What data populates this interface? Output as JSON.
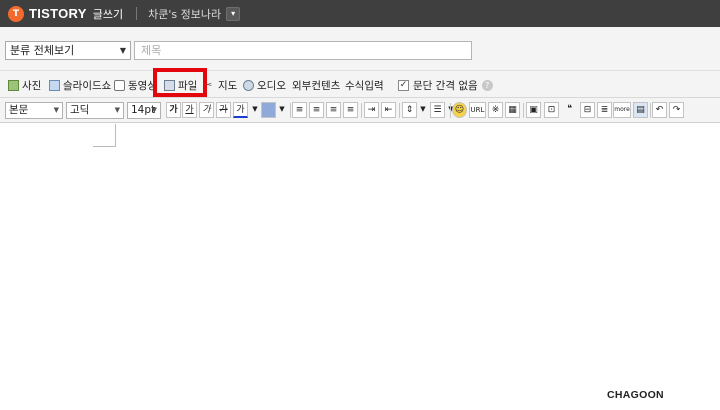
{
  "topbar": {
    "logo_icon": "T",
    "logo_text": "TISTORY",
    "write_label": "글쓰기",
    "blog_name": "차쿤's 정보나라",
    "blog_dropdown_glyph": "▾"
  },
  "category": {
    "selected": "분류 전체보기",
    "arrow": "▼"
  },
  "title": {
    "placeholder": "제목"
  },
  "attachments": {
    "photo": "사진",
    "slideshow": "슬라이드쇼",
    "video": "동영상",
    "file": "파일",
    "map": "지도",
    "audio": "오디오",
    "external": "외부컨텐츠",
    "formula": "수식입력",
    "no_paragraph_spacing": "문단 간격 없음",
    "help": "?"
  },
  "format": {
    "paragraph": "본문",
    "font": "고딕",
    "size": "14pt",
    "arrow": "▼",
    "bold": "가",
    "underline": "가",
    "italic": "가",
    "strike": "가",
    "text_color": "가",
    "url": "URL",
    "reference": "※",
    "quote": "❝",
    "more": "more",
    "undo": "↶",
    "redo": "↷"
  },
  "watermark": "CHAGOON",
  "colors": {
    "topbar_bg": "#3f3f3f",
    "logo": "#f26a2e",
    "highlight": "#e4060d"
  }
}
